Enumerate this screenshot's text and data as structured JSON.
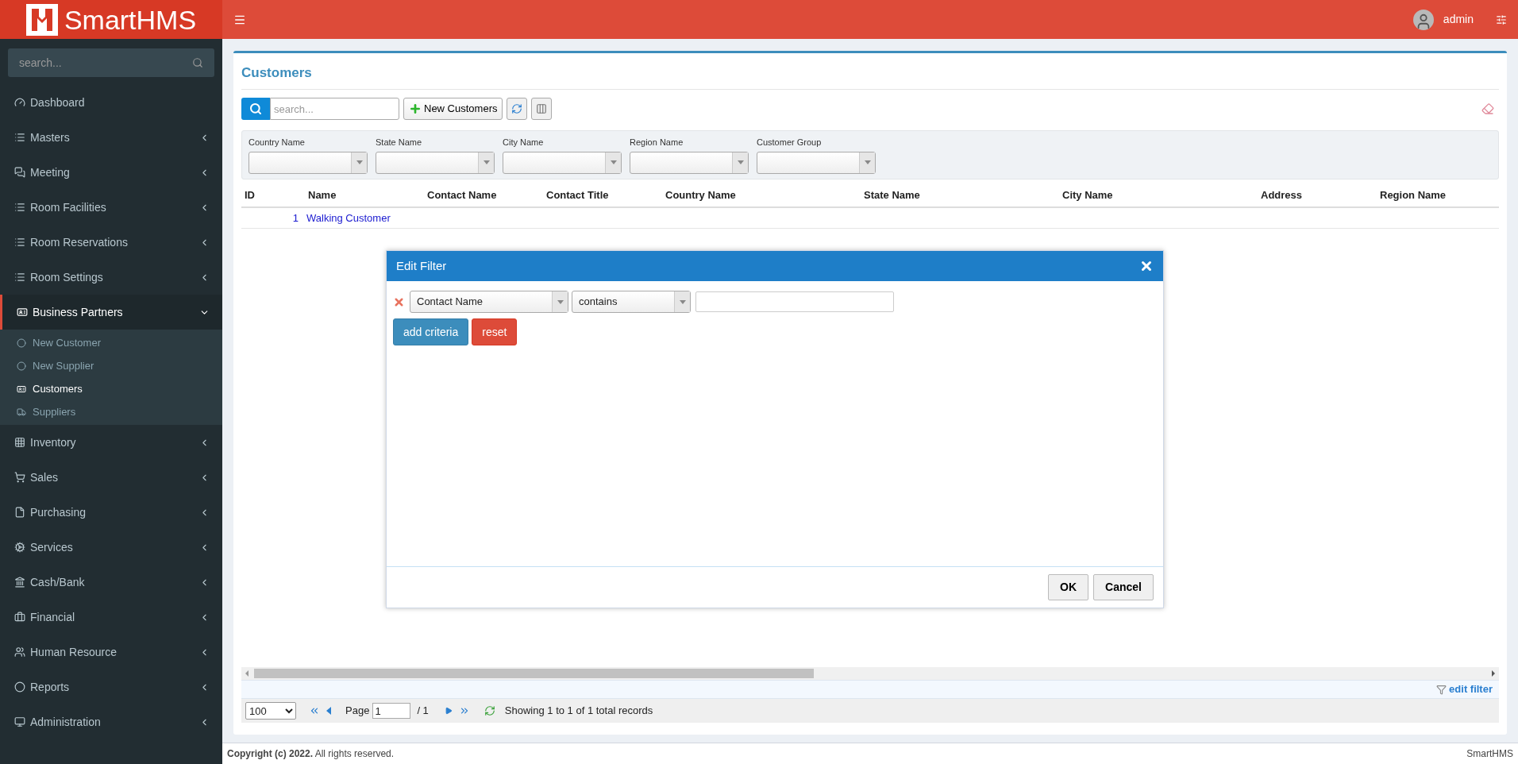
{
  "brand": "SmartHMS",
  "user": {
    "name": "admin"
  },
  "sidebar": {
    "search_placeholder": "search...",
    "items": [
      {
        "label": "Dashboard",
        "selected": false
      },
      {
        "label": "Masters",
        "selected": false,
        "expanded": false
      },
      {
        "label": "Meeting",
        "selected": false,
        "expanded": false
      },
      {
        "label": "Room Facilities",
        "selected": false,
        "expanded": false
      },
      {
        "label": "Room Reservations",
        "selected": false,
        "expanded": false
      },
      {
        "label": "Room Settings",
        "selected": false,
        "expanded": false
      },
      {
        "label": "Business Partners",
        "selected": true,
        "expanded": true,
        "children": [
          {
            "label": "New Customer",
            "selected": false
          },
          {
            "label": "New Supplier",
            "selected": false
          },
          {
            "label": "Customers",
            "selected": true
          },
          {
            "label": "Suppliers",
            "selected": false
          }
        ]
      },
      {
        "label": "Inventory",
        "selected": false,
        "expanded": false
      },
      {
        "label": "Sales",
        "selected": false,
        "expanded": false
      },
      {
        "label": "Purchasing",
        "selected": false,
        "expanded": false
      },
      {
        "label": "Services",
        "selected": false,
        "expanded": false
      },
      {
        "label": "Cash/Bank",
        "selected": false,
        "expanded": false
      },
      {
        "label": "Financial",
        "selected": false,
        "expanded": false
      },
      {
        "label": "Human Resource",
        "selected": false,
        "expanded": false
      },
      {
        "label": "Reports",
        "selected": false,
        "expanded": false
      },
      {
        "label": "Administration",
        "selected": false,
        "expanded": false
      }
    ]
  },
  "page": {
    "title": "Customers",
    "search_placeholder": "search...",
    "new_button": "New Customers"
  },
  "filters": [
    {
      "label": "Country Name"
    },
    {
      "label": "State Name"
    },
    {
      "label": "City Name"
    },
    {
      "label": "Region Name"
    },
    {
      "label": "Customer Group"
    }
  ],
  "table": {
    "columns": [
      "ID",
      "Name",
      "Contact Name",
      "Contact Title",
      "Country Name",
      "State Name",
      "City Name",
      "Address",
      "Region Name"
    ],
    "rows": [
      {
        "id": "1",
        "name": "Walking Customer"
      }
    ]
  },
  "edit_filter": "edit filter",
  "pager": {
    "page_size": "100",
    "page_label": "Page",
    "page": "1",
    "total_pages": "/ 1",
    "summary": "Showing 1 to 1 of 1 total records"
  },
  "dialog": {
    "title": "Edit Filter",
    "criteria": [
      {
        "field": "Contact Name",
        "operator": "contains"
      }
    ],
    "add_button": "add criteria",
    "reset_button": "reset",
    "ok_button": "OK",
    "cancel_button": "Cancel"
  },
  "footer": {
    "copyright": "**Copyright (c) 2022.** All rights reserved.",
    "brand": "SmartHMS"
  }
}
